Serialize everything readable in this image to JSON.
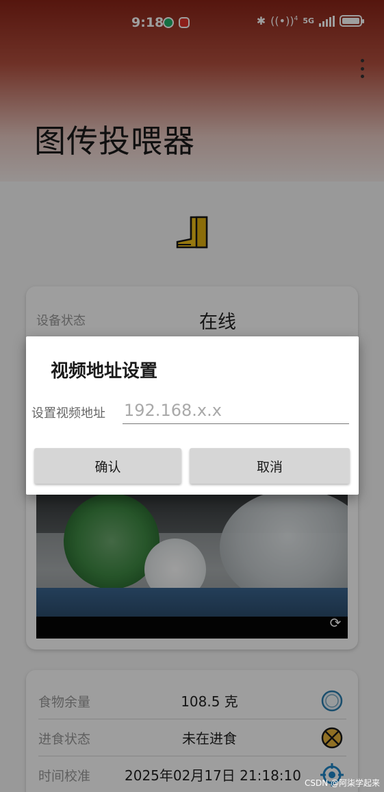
{
  "status_bar": {
    "time": "9:18",
    "network_sup": "4",
    "network_label": "5G"
  },
  "app": {
    "title": "图传投喂器",
    "menu_icon": "overflow-menu-icon"
  },
  "device": {
    "status_label": "设备状态",
    "status_value": "在线"
  },
  "info": {
    "food_label": "食物余量",
    "food_value": "108.5 克",
    "eating_label": "进食状态",
    "eating_value": "未在进食",
    "time_label": "时间校准",
    "time_value": "2025年02月17日 21:18:10"
  },
  "dialog": {
    "title": "视频地址设置",
    "field_label": "设置视频地址",
    "input_value": "",
    "input_placeholder": "192.168.x.x",
    "confirm_label": "确认",
    "cancel_label": "取消"
  },
  "watermark": "CSDN @阿柒学起来",
  "colors": {
    "header_top": "#8a2418",
    "button_bg": "#d6d6d6",
    "online_text": "#222222"
  }
}
